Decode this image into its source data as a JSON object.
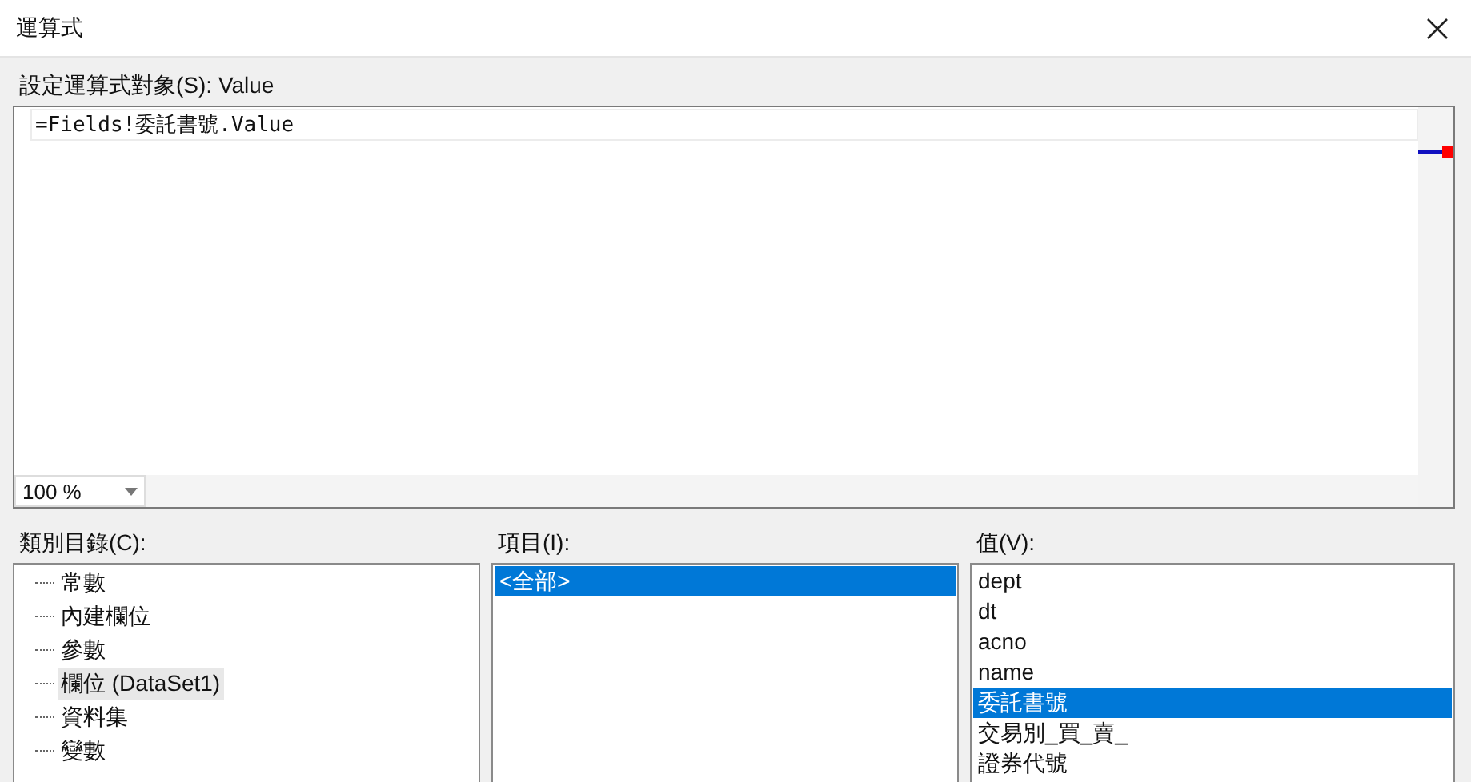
{
  "window": {
    "title": "運算式"
  },
  "expression": {
    "label": "設定運算式對象(S): Value",
    "value": "=Fields!委託書號.Value",
    "zoom": "100 %"
  },
  "category": {
    "label": "類別目錄(C):",
    "items": [
      {
        "label": "常數",
        "selected": false
      },
      {
        "label": "內建欄位",
        "selected": false
      },
      {
        "label": "參數",
        "selected": false
      },
      {
        "label": "欄位 (DataSet1)",
        "selected": true
      },
      {
        "label": "資料集",
        "selected": false
      },
      {
        "label": "變數",
        "selected": false
      }
    ]
  },
  "item_list": {
    "label": "項目(I):",
    "items": [
      {
        "label": "<全部>",
        "selected": true
      }
    ]
  },
  "values": {
    "label": "值(V):",
    "items": [
      {
        "label": "dept",
        "selected": false
      },
      {
        "label": "dt",
        "selected": false
      },
      {
        "label": "acno",
        "selected": false
      },
      {
        "label": "name",
        "selected": false
      },
      {
        "label": "委託書號",
        "selected": true
      },
      {
        "label": "交易別_買_賣_",
        "selected": false
      },
      {
        "label": "證券代號",
        "selected": false
      }
    ]
  }
}
